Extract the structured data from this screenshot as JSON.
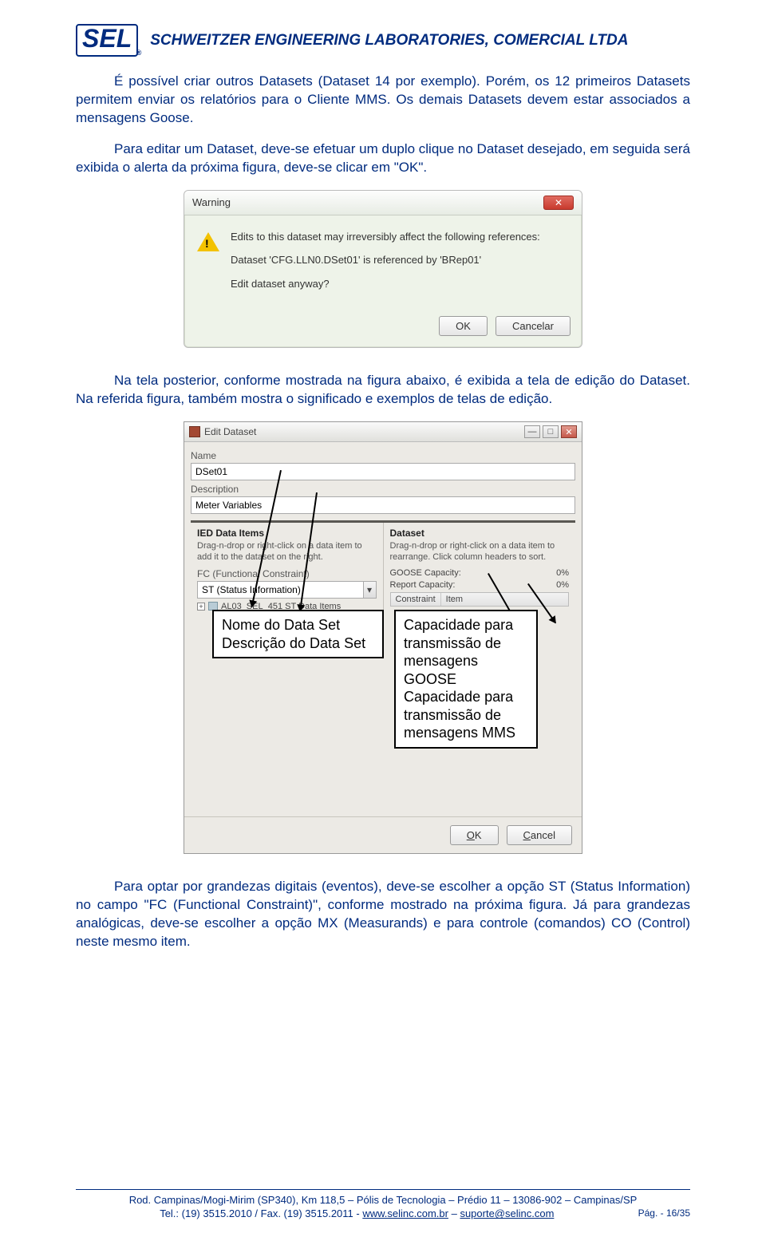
{
  "header": {
    "logo_text": "SEL",
    "company": "SCHWEITZER ENGINEERING LABORATORIES, COMERCIAL LTDA"
  },
  "body": {
    "p1": "É possível criar outros Datasets (Dataset 14 por exemplo). Porém, os 12 primeiros Datasets permitem enviar os relatórios para o Cliente MMS. Os demais Datasets devem estar associados a mensagens Goose.",
    "p2": "Para editar um Dataset, deve-se efetuar um duplo clique no Dataset desejado, em seguida será exibida o alerta da próxima figura, deve-se clicar em \"OK\".",
    "p3": "Na tela posterior, conforme mostrada na figura abaixo, é exibida a tela de edição do Dataset. Na referida figura, também mostra o significado e exemplos de telas de edição.",
    "p4": "Para optar por grandezas digitais (eventos), deve-se escolher a opção ST (Status Information) no campo \"FC (Functional Constraint)\", conforme mostrado na próxima figura. Já para grandezas analógicas, deve-se escolher a opção MX (Measurands) e para controle (comandos)  CO (Control) neste mesmo item."
  },
  "dlg1": {
    "title": "Warning",
    "line1": "Edits to this dataset may irreversibly affect the following references:",
    "line2": "Dataset 'CFG.LLN0.DSet01' is referenced by 'BRep01'",
    "line3": "Edit dataset anyway?",
    "ok": "OK",
    "cancel": "Cancelar"
  },
  "dlg2": {
    "title": "Edit Dataset",
    "name_lbl": "Name",
    "name_val": "DSet01",
    "desc_lbl": "Description",
    "desc_val": "Meter Variables",
    "left": {
      "title": "IED Data Items",
      "desc": "Drag-n-drop or right-click on a data item to add it to the dataset on the right.",
      "fc_lbl": "FC (Functional Constraint)",
      "fc_val": "ST (Status Information)",
      "tree": "AL03_SEL_451 ST Data Items"
    },
    "right": {
      "title": "Dataset",
      "desc": "Drag-n-drop or right-click on a data item to rearrange. Click column headers to sort.",
      "goose_lbl": "GOOSE Capacity:",
      "goose_val": "0%",
      "report_lbl": "Report Capacity:",
      "report_val": "0%",
      "col1": "Constraint",
      "col2": "Item"
    },
    "ok": "OK",
    "cancel": "Cancel"
  },
  "callouts": {
    "c1": "Nome do Data Set\nDescrição do Data Set",
    "c2": "Capacidade para transmissão de mensagens GOOSE\nCapacidade para transmissão de mensagens MMS"
  },
  "footer": {
    "l1": "Rod. Campinas/Mogi-Mirim (SP340), Km 118,5 – Pólis de Tecnologia – Prédio 11 – 13086-902 – Campinas/SP",
    "l2_pre": "Tel.: (19) 3515.2010 / Fax. (19) 3515.2011 - ",
    "link1": "www.selinc.com.br",
    "l2_mid": " – ",
    "link2": "suporte@selinc.com",
    "page": "Pág. - 16/35"
  }
}
